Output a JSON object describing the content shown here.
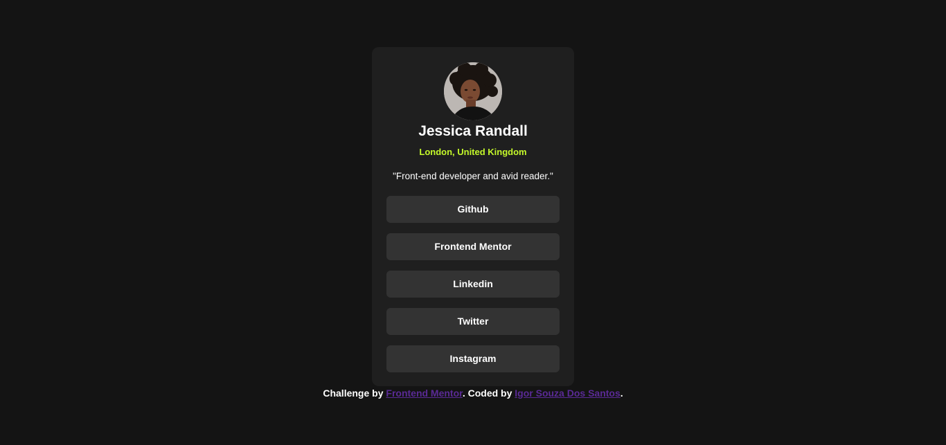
{
  "profile": {
    "name": "Jessica Randall",
    "location": "London, United Kingdom",
    "bio": "\"Front-end developer and avid reader.\""
  },
  "links": [
    {
      "label": "Github"
    },
    {
      "label": "Frontend Mentor"
    },
    {
      "label": "Linkedin"
    },
    {
      "label": "Twitter"
    },
    {
      "label": "Instagram"
    }
  ],
  "attribution": {
    "prefix": "Challenge by ",
    "challenge_link": "Frontend Mentor",
    "middle": ". Coded by ",
    "author_link": "Igor Souza Dos Santos",
    "suffix": "."
  },
  "colors": {
    "background": "#141414",
    "card": "#1f1f1f",
    "button": "#333333",
    "accent": "#c4f82a",
    "link": "#5a2a96"
  }
}
